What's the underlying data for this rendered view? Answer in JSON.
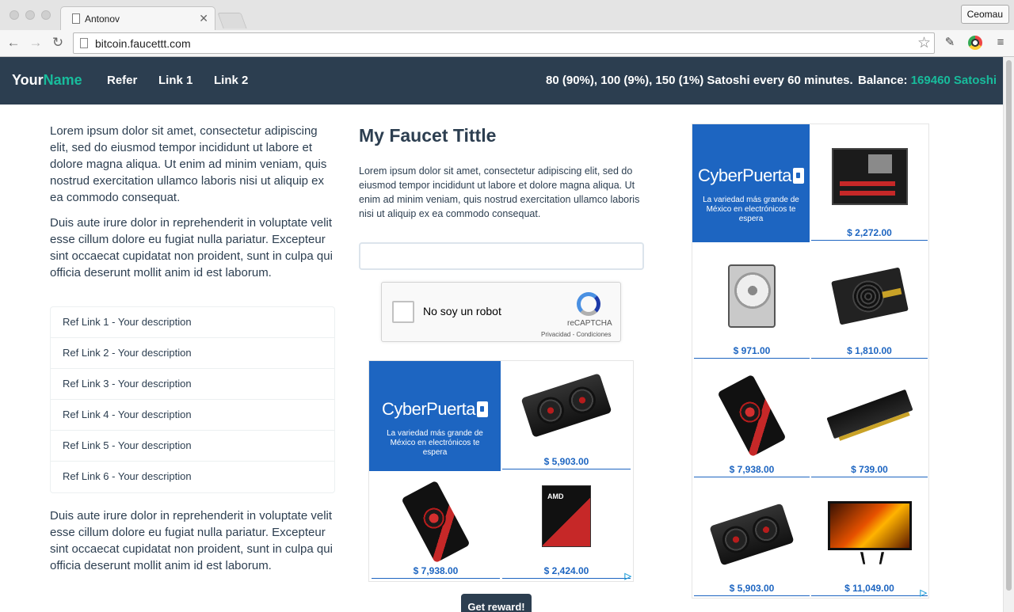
{
  "browser": {
    "tab_title": "Antonov",
    "url": "bitcoin.faucettt.com",
    "profile_name": "Ceomau"
  },
  "navbar": {
    "brand_part1": "Your",
    "brand_part2": "Name",
    "links": [
      "Refer",
      "Link 1",
      "Link 2"
    ],
    "rate_text": "80 (90%), 100 (9%), 150 (1%) Satoshi every 60 minutes.",
    "balance_label": "Balance:",
    "balance_value": "169460 Satoshi"
  },
  "left": {
    "para1": "Lorem ipsum dolor sit amet, consectetur adipiscing elit, sed do eiusmod tempor incididunt ut labore et dolore magna aliqua. Ut enim ad minim veniam, quis nostrud exercitation ullamco laboris nisi ut aliquip ex ea commodo consequat.",
    "para2": "Duis aute irure dolor in reprehenderit in voluptate velit esse cillum dolore eu fugiat nulla pariatur. Excepteur sint occaecat cupidatat non proident, sunt in culpa qui officia deserunt mollit anim id est laborum.",
    "ref_links": [
      "Ref Link 1 - Your description",
      "Ref Link 2 - Your description",
      "Ref Link 3 - Your description",
      "Ref Link 4 - Your description",
      "Ref Link 5 - Your description",
      "Ref Link 6 - Your description"
    ],
    "para3": "Duis aute irure dolor in reprehenderit in voluptate velit esse cillum dolore eu fugiat nulla pariatur. Excepteur sint occaecat cupidatat non proident, sunt in culpa qui officia deserunt mollit anim id est laborum."
  },
  "middle": {
    "title": "My Faucet Tittle",
    "description": "Lorem ipsum dolor sit amet, consectetur adipiscing elit, sed do eiusmod tempor incididunt ut labore et dolore magna aliqua. Ut enim ad minim veniam, quis nostrud exercitation ullamco laboris nisi ut aliquip ex ea commodo consequat.",
    "address_value": "",
    "captcha_label": "No soy un robot",
    "captcha_brand": "reCAPTCHA",
    "captcha_links": "Privacidad - Condiciones",
    "reward_button": "Get reward!"
  },
  "ads": {
    "brand_name": "CyberPuerta",
    "tagline": "La variedad más grande de México en electrónicos te espera",
    "middle_prices": [
      "$ 5,903.00",
      "$ 7,938.00",
      "$ 2,424.00"
    ],
    "right_prices": [
      "$ 2,272.00",
      "$ 971.00",
      "$ 1,810.00",
      "$ 7,938.00",
      "$ 739.00",
      "$ 5,903.00",
      "$ 11,049.00"
    ],
    "brand_color": "#1d65c1"
  },
  "colors": {
    "navbar": "#2c3e50",
    "accent": "#18bc9c"
  }
}
